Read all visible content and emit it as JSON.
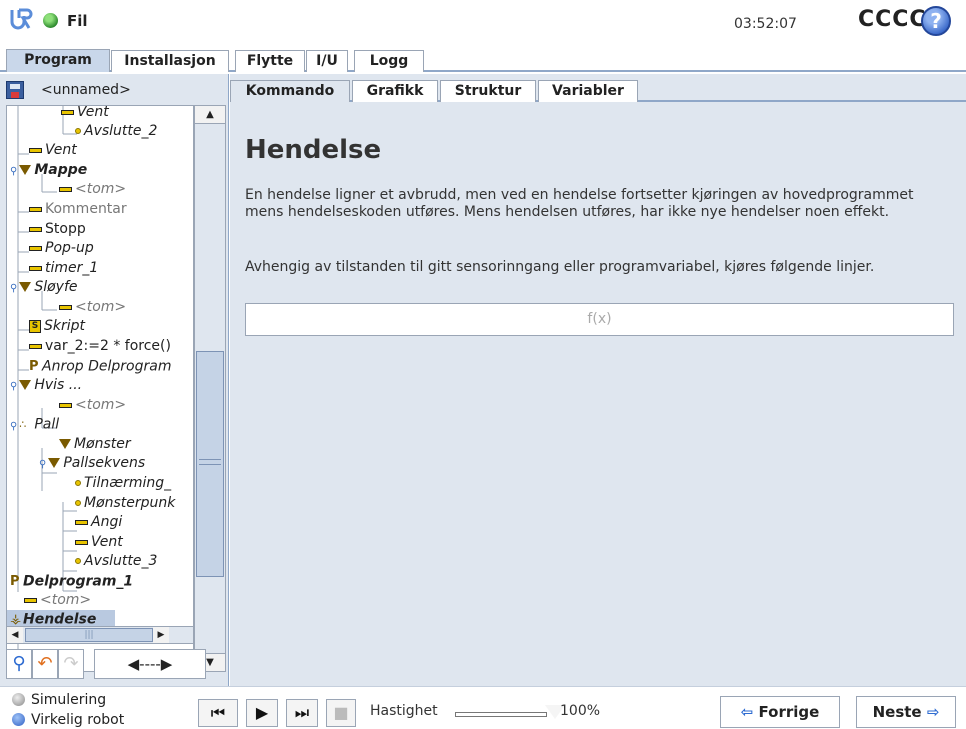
{
  "header": {
    "file_label": "Fil",
    "clock": "03:52:07",
    "robot_name": "CCCC",
    "help_symbol": "?"
  },
  "main_tabs": [
    "Program",
    "Installasjon",
    "Flytte",
    "I/U",
    "Logg"
  ],
  "main_tabs_active": "Program",
  "left_panel": {
    "program_name": "<unnamed>",
    "tree": [
      {
        "label": "Vent",
        "icon": "wait-icon",
        "style": "italic"
      },
      {
        "label": "Avslutte_2",
        "icon": "waypoint-icon",
        "style": "italic"
      },
      {
        "label": "Vent",
        "icon": "wait-icon",
        "style": "italic"
      },
      {
        "label": "Mappe",
        "icon": "folder-icon",
        "style": "bold-italic"
      },
      {
        "label": "<tom>",
        "icon": "empty-icon",
        "style": "grey"
      },
      {
        "label": "Kommentar",
        "icon": "comment-icon",
        "style": "grey-normal"
      },
      {
        "label": "Stopp",
        "icon": "stop-icon",
        "style": "normal"
      },
      {
        "label": "Pop-up",
        "icon": "popup-icon",
        "style": "italic"
      },
      {
        "label": "timer_1",
        "icon": "timer-icon",
        "style": "italic"
      },
      {
        "label": "Sløyfe",
        "icon": "loop-icon",
        "style": "italic"
      },
      {
        "label": "<tom>",
        "icon": "empty-icon",
        "style": "grey"
      },
      {
        "label": "Skript",
        "icon": "script-icon",
        "style": "italic"
      },
      {
        "label": "var_2:=2 * force()",
        "icon": "assign-icon",
        "style": "normal"
      },
      {
        "label": "Anrop Delprogram",
        "icon": "subprogram-call-icon",
        "style": "italic"
      },
      {
        "label": "Hvis ...",
        "icon": "if-icon",
        "style": "italic"
      },
      {
        "label": "<tom>",
        "icon": "empty-icon",
        "style": "grey"
      },
      {
        "label": "Pall",
        "icon": "pallet-icon",
        "style": "italic"
      },
      {
        "label": "Mønster",
        "icon": "pattern-icon",
        "style": "italic"
      },
      {
        "label": "Pallsekvens",
        "icon": "sequence-icon",
        "style": "italic"
      },
      {
        "label": "Tilnærming_",
        "icon": "waypoint-icon",
        "style": "italic"
      },
      {
        "label": "Mønsterpunk",
        "icon": "waypoint-icon",
        "style": "italic"
      },
      {
        "label": "Angi",
        "icon": "set-icon",
        "style": "italic"
      },
      {
        "label": "Vent",
        "icon": "wait-icon",
        "style": "italic"
      },
      {
        "label": "Avslutte_3",
        "icon": "waypoint-icon",
        "style": "italic"
      },
      {
        "label": "Delprogram_1",
        "icon": "subprogram-icon",
        "style": "bold-italic"
      },
      {
        "label": "<tom>",
        "icon": "empty-icon",
        "style": "grey"
      },
      {
        "label": "Hendelse",
        "icon": "event-icon",
        "style": "bold-italic",
        "selected": true
      }
    ]
  },
  "sub_tabs": [
    "Kommando",
    "Grafikk",
    "Struktur",
    "Variabler"
  ],
  "sub_tabs_active": "Kommando",
  "content": {
    "title": "Hendelse",
    "paragraph1": "En hendelse ligner et avbrudd, men ved en hendelse fortsetter kjøringen av hovedprogrammet mens hendelseskoden utføres. Mens hendelsen utføres, har ikke nye hendelser noen effekt.",
    "paragraph2": "Avhengig av tilstanden til gitt sensorinngang eller programvariabel, kjøres følgende linjer.",
    "expression_placeholder": "f(x)"
  },
  "footer": {
    "simulation_label": "Simulering",
    "real_robot_label": "Virkelig robot",
    "speed_label": "Hastighet",
    "speed_value": "100%",
    "speed_fraction": 1.0,
    "prev_label": "Forrige",
    "next_label": "Neste"
  },
  "colors": {
    "panel_bg": "#dfe6ef",
    "tab_active": "#c9d7ea",
    "accent_blue": "#2d6bd1",
    "status_green": "#2e8b2e"
  }
}
